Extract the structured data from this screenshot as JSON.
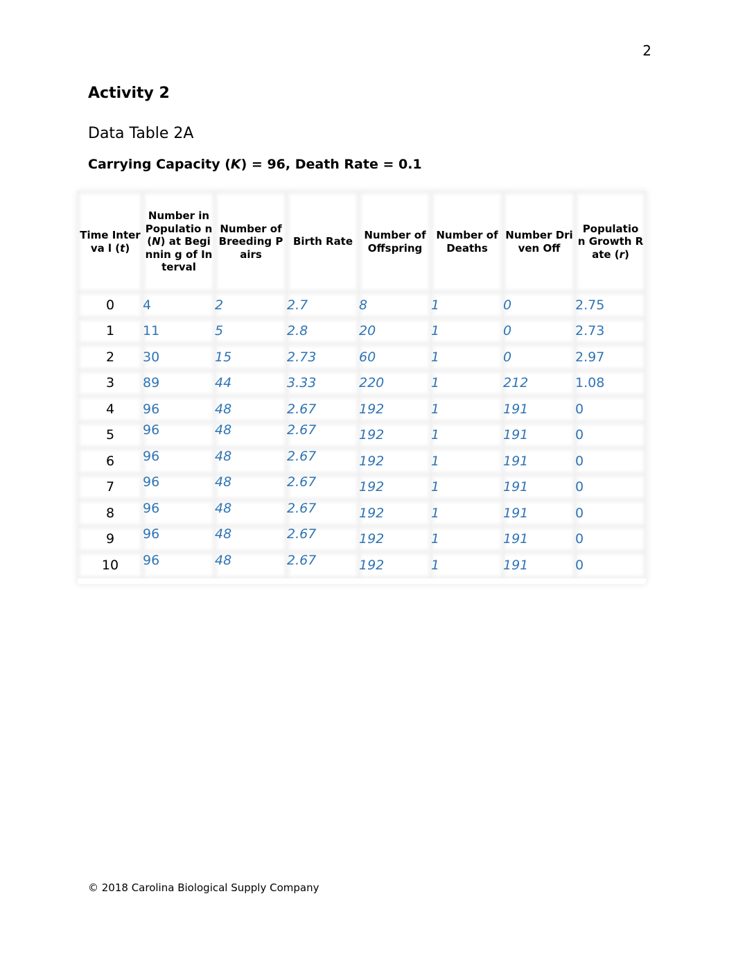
{
  "page": {
    "number": "2"
  },
  "document": {
    "activity_title": "Activity 2",
    "table_title": "Data Table 2A",
    "table_subtitle_prefix": "Carrying Capacity (",
    "table_subtitle_k": "K",
    "table_subtitle_suffix": ") = 96, Death Rate = 0.1",
    "footer": "© 2018 Carolina Biological Supply Company"
  },
  "table": {
    "headers": [
      {
        "pre": "Time Interva l (",
        "var": "t",
        "post": ")"
      },
      {
        "pre": "Number in Populatio n (",
        "var": "N",
        "post": ") at Beginnin g of Interval"
      },
      {
        "pre": "Number of Breeding Pairs",
        "var": "",
        "post": ""
      },
      {
        "pre": "Birth Rate",
        "var": "",
        "post": ""
      },
      {
        "pre": "Number of Offspring",
        "var": "",
        "post": ""
      },
      {
        "pre": "Number of Deaths",
        "var": "",
        "post": ""
      },
      {
        "pre": "Number Driven Off",
        "var": "",
        "post": ""
      },
      {
        "pre": "Populatio n Growth Rate (",
        "var": "r",
        "post": ")"
      }
    ],
    "rows": [
      {
        "t": "0",
        "n": "4",
        "pairs": "2",
        "birth": "2.7",
        "offspring": "8",
        "deaths": "1",
        "driven": "0",
        "r": "2.75"
      },
      {
        "t": "1",
        "n": "11",
        "pairs": "5",
        "birth": "2.8",
        "offspring": "20",
        "deaths": "1",
        "driven": "0",
        "r": "2.73"
      },
      {
        "t": "2",
        "n": "30",
        "pairs": "15",
        "birth": "2.73",
        "offspring": "60",
        "deaths": "1",
        "driven": "0",
        "r": "2.97"
      },
      {
        "t": "3",
        "n": "89",
        "pairs": "44",
        "birth": "3.33",
        "offspring": "220",
        "deaths": "1",
        "driven": "212",
        "r": "1.08"
      },
      {
        "t": "4",
        "n": "96",
        "pairs": "48",
        "birth": "2.67",
        "offspring": "192",
        "deaths": "1",
        "driven": "191",
        "r": "0"
      },
      {
        "t": "5",
        "n": "96",
        "pairs": "48",
        "birth": "2.67",
        "offspring": "192",
        "deaths": "1",
        "driven": "191",
        "r": "0"
      },
      {
        "t": "6",
        "n": "96",
        "pairs": "48",
        "birth": "2.67",
        "offspring": "192",
        "deaths": "1",
        "driven": "191",
        "r": "0"
      },
      {
        "t": "7",
        "n": "96",
        "pairs": "48",
        "birth": "2.67",
        "offspring": "192",
        "deaths": "1",
        "driven": "191",
        "r": "0"
      },
      {
        "t": "8",
        "n": "96",
        "pairs": "48",
        "birth": "2.67",
        "offspring": "192",
        "deaths": "1",
        "driven": "191",
        "r": "0"
      },
      {
        "t": "9",
        "n": "96",
        "pairs": "48",
        "birth": "2.67",
        "offspring": "192",
        "deaths": "1",
        "driven": "191",
        "r": "0"
      },
      {
        "t": "10",
        "n": "96",
        "pairs": "48",
        "birth": "2.67",
        "offspring": "192",
        "deaths": "1",
        "driven": "191",
        "r": "0"
      }
    ]
  },
  "colors": {
    "entered_value": "#2e74b5",
    "text": "#000000"
  }
}
